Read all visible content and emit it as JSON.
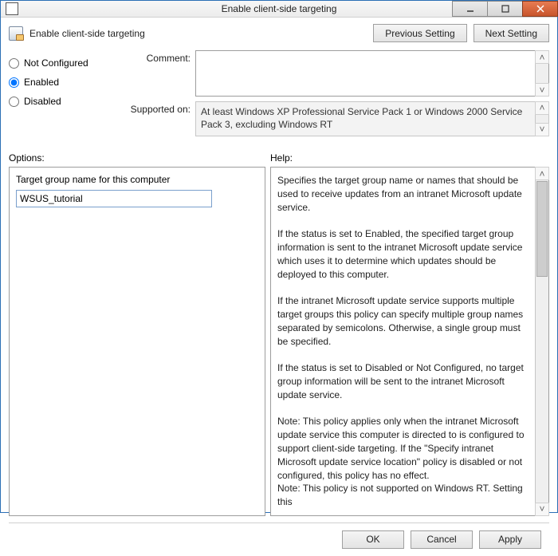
{
  "window": {
    "title": "Enable client-side targeting"
  },
  "header": {
    "label": "Enable client-side targeting"
  },
  "nav": {
    "previous": "Previous Setting",
    "next": "Next Setting"
  },
  "state": {
    "options": [
      {
        "label": "Not Configured",
        "value": false
      },
      {
        "label": "Enabled",
        "value": true
      },
      {
        "label": "Disabled",
        "value": false
      }
    ]
  },
  "fields": {
    "comment_label": "Comment:",
    "comment_value": "",
    "supported_label": "Supported on:",
    "supported_value": "At least Windows XP Professional Service Pack 1 or Windows 2000 Service Pack 3, excluding Windows RT"
  },
  "section_labels": {
    "options": "Options:",
    "help": "Help:"
  },
  "options_pane": {
    "target_group_label": "Target group name for this computer",
    "target_group_value": "WSUS_tutorial"
  },
  "help_text": "Specifies the target group name or names that should be used to receive updates from an intranet Microsoft update service.\n\nIf the status is set to Enabled, the specified target group information is sent to the intranet Microsoft update service which uses it to determine which updates should be deployed to this computer.\n\nIf the intranet Microsoft update service supports multiple target groups this policy can specify multiple group names separated by semicolons. Otherwise, a single group must be specified.\n\nIf the status is set to Disabled or Not Configured, no target group information will be sent to the intranet Microsoft update service.\n\nNote: This policy applies only when the intranet Microsoft update service this computer is directed to is configured to support client-side targeting. If the \"Specify intranet Microsoft update service location\" policy is disabled or not configured, this policy has no effect.\nNote: This policy is not supported on Windows RT. Setting this",
  "footer": {
    "ok": "OK",
    "cancel": "Cancel",
    "apply": "Apply"
  }
}
